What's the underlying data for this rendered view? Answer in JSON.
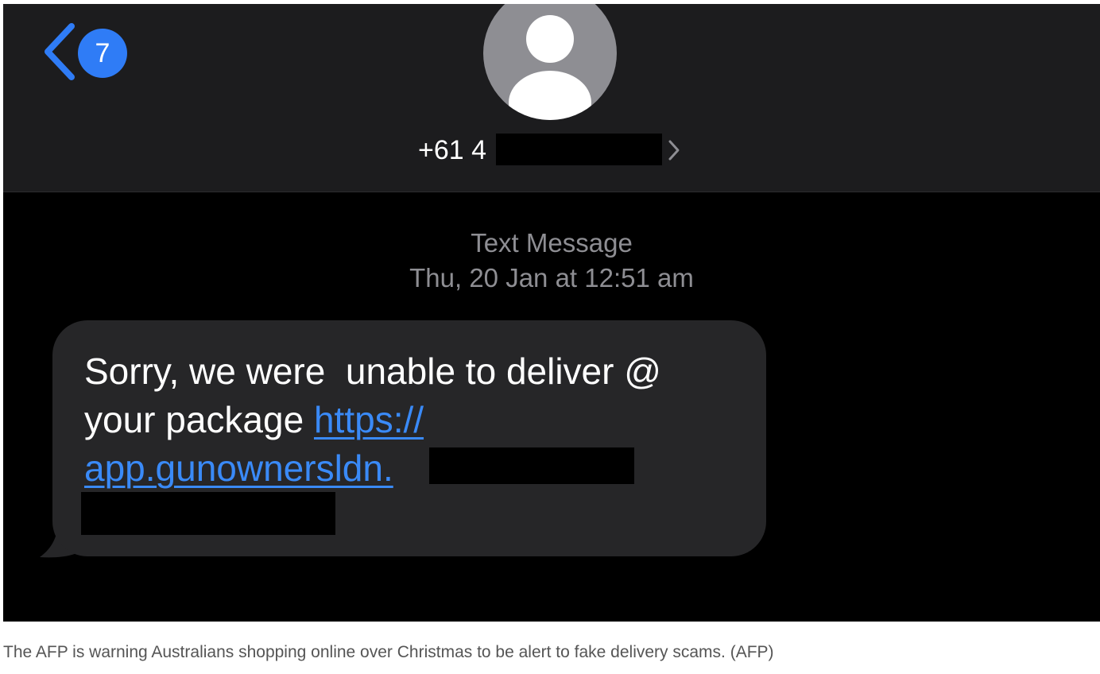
{
  "header": {
    "back_badge_count": "7",
    "contact_number": "+61 4"
  },
  "thread": {
    "message_type": "Text Message",
    "timestamp": "Thu, 20 Jan at 12:51 am"
  },
  "message": {
    "line1": "Sorry, we were  unable to deliver @",
    "line2_text": "your package ",
    "link_part1": "https://",
    "link_part2": "app.gunownersldn."
  },
  "caption": "The AFP is warning Australians shopping online over Christmas to be alert to fake delivery scams. (AFP)",
  "colors": {
    "header_bg": "#1c1c1e",
    "screen_bg": "#000000",
    "bubble_bg": "#262628",
    "accent_blue": "#2f7cf6",
    "link_blue": "#3a8af7",
    "meta_gray": "#8e8e93"
  },
  "icons": {
    "back": "chevron-left-icon",
    "avatar": "person-silhouette-icon",
    "contact_details": "chevron-right-icon"
  }
}
